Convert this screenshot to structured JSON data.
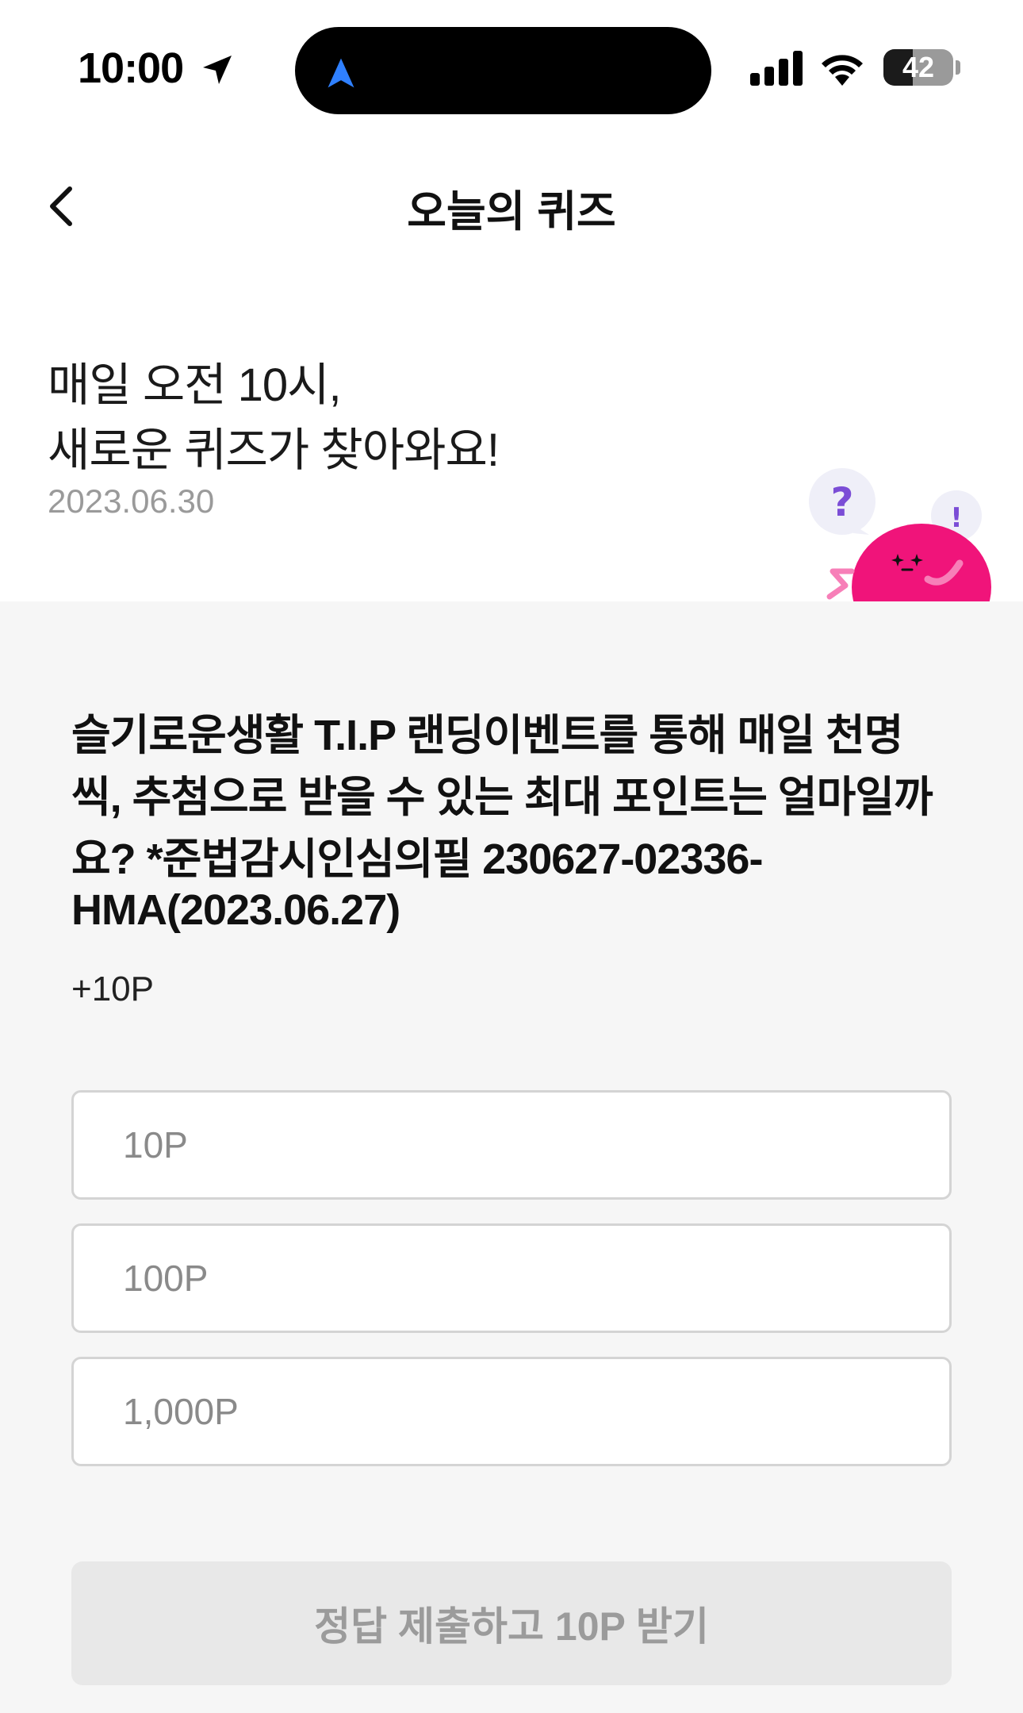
{
  "status_bar": {
    "time": "10:00",
    "battery": "42",
    "battery_level": 0.42
  },
  "nav": {
    "title": "오늘의 퀴즈"
  },
  "hero": {
    "line1": "매일 오전 10시,",
    "line2": "새로운 퀴즈가 찾아와요!",
    "date": "2023.06.30"
  },
  "quiz": {
    "question_lines": [
      "슬기로운생활 T.I.P 랜딩이벤트를 통해 매일 천명",
      "씩, 추첨으로 받을 수 있는 최대 포인트는 얼마일까",
      "요? *준법감시인심의필 230627-02336-",
      "HMA(2023.06.27)"
    ],
    "reward": "+10P",
    "options": [
      "10P",
      "100P",
      "1,000P"
    ],
    "submit_label": "정답 제출하고 10P 받기"
  },
  "colors": {
    "mascot": "#f0147a",
    "bubble": "#efeff8",
    "bubble_mark": "#7b4dd6",
    "panel_bg": "#f6f6f6",
    "submit_bg": "#e8e8e8"
  }
}
